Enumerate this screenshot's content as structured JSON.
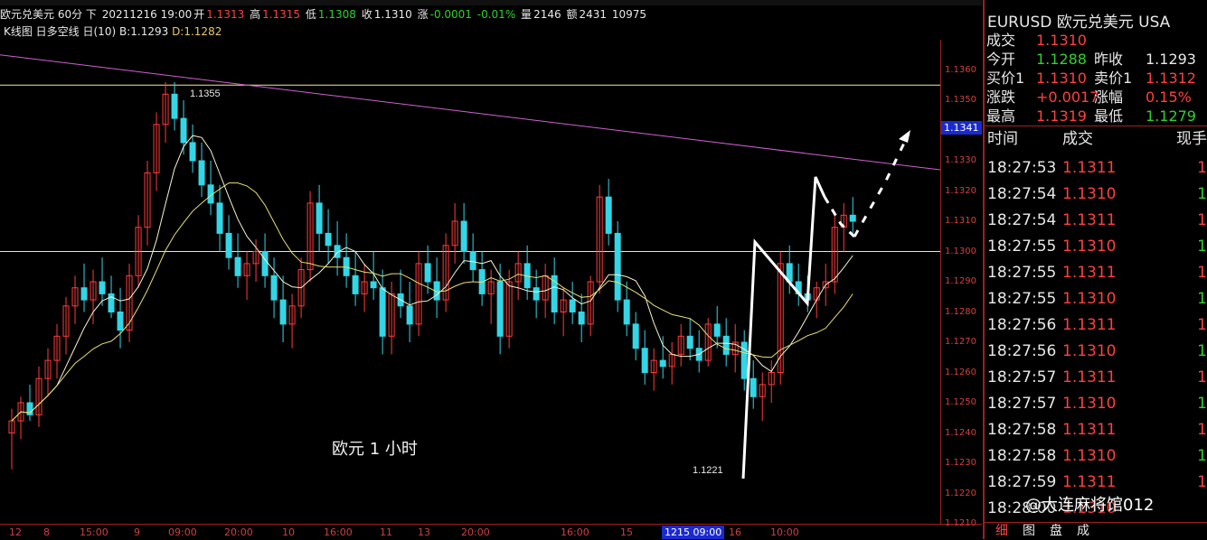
{
  "infobar": {
    "symbol_period": "欧元兑美元 60分 下",
    "datetime": "20211216 19:00",
    "open_label": "开",
    "open": "1.1313",
    "high_label": "高",
    "high": "1.1315",
    "low_label": "低",
    "low": "1.1308",
    "close_label": "收",
    "close": "1.1310",
    "change_label": "涨",
    "change": "-0.0001",
    "change_pct": "-0.01%",
    "volume_label": "量",
    "volume": "2146",
    "amount_label": "额",
    "amount": "2431",
    "extra": "10975"
  },
  "indicator_bar": {
    "name": "K线图 日多空线 日(10)",
    "b": "B:1.1293",
    "d": "D:1.1282"
  },
  "price_axis": {
    "ticks": [
      "1.1360",
      "1.1350",
      "1.1340",
      "1.1330",
      "1.1320",
      "1.1310",
      "1.1300",
      "1.1290",
      "1.1280",
      "1.1270",
      "1.1260",
      "1.1250",
      "1.1240",
      "1.1230",
      "1.1220",
      "1.1210"
    ],
    "current_price": "1.1341"
  },
  "time_axis": {
    "labels": [
      "12",
      "8",
      "15:00",
      "9",
      "09:00",
      "20:00",
      "10",
      "16:00",
      "11",
      "13",
      "20:00",
      "16:00",
      "15",
      "1215 09:00",
      "16",
      "10:00"
    ],
    "highlight": "1215 09:00"
  },
  "annotations": {
    "high_label": "1.1355",
    "low_label": "1.1221",
    "chart_text": "欧元  1 小时"
  },
  "quote": {
    "title": "EURUSD  欧元兑美元    USA",
    "rows": [
      {
        "label": "成交",
        "value": "1.1310",
        "color": "#ff4040"
      },
      {
        "label": "今开",
        "value": "1.1288",
        "color": "#2fd12f",
        "label2": "昨收",
        "value2": "1.1293",
        "color2": "#e8e8e8"
      },
      {
        "label": "买价1",
        "value": "1.1310",
        "color": "#ff4040",
        "label2": "卖价1",
        "value2": "1.1312",
        "color2": "#ff4040"
      },
      {
        "label": "涨跌",
        "value": "+0.0017",
        "color": "#ff4040",
        "label2": "涨幅",
        "value2": "0.15%",
        "color2": "#ff4040"
      },
      {
        "label": "最高",
        "value": "1.1319",
        "color": "#ff4040",
        "label2": "最低",
        "value2": "1.1279",
        "color2": "#2fd12f"
      }
    ],
    "head_time": "时间",
    "head_price": "成交",
    "head_hand": "现手",
    "ticks": [
      {
        "time": "18:27:53",
        "price": "1.1311",
        "hand": "1",
        "pc": "#ff4040",
        "hc": "#ff4040"
      },
      {
        "time": "18:27:54",
        "price": "1.1310",
        "hand": "1",
        "pc": "#ff4040",
        "hc": "#2fd12f"
      },
      {
        "time": "18:27:54",
        "price": "1.1311",
        "hand": "1",
        "pc": "#ff4040",
        "hc": "#ff4040"
      },
      {
        "time": "18:27:55",
        "price": "1.1310",
        "hand": "1",
        "pc": "#ff4040",
        "hc": "#2fd12f"
      },
      {
        "time": "18:27:55",
        "price": "1.1311",
        "hand": "1",
        "pc": "#ff4040",
        "hc": "#ff4040"
      },
      {
        "time": "18:27:55",
        "price": "1.1310",
        "hand": "1",
        "pc": "#ff4040",
        "hc": "#2fd12f"
      },
      {
        "time": "18:27:56",
        "price": "1.1311",
        "hand": "1",
        "pc": "#ff4040",
        "hc": "#ff4040"
      },
      {
        "time": "18:27:56",
        "price": "1.1310",
        "hand": "1",
        "pc": "#ff4040",
        "hc": "#2fd12f"
      },
      {
        "time": "18:27:57",
        "price": "1.1311",
        "hand": "1",
        "pc": "#ff4040",
        "hc": "#ff4040"
      },
      {
        "time": "18:27:57",
        "price": "1.1310",
        "hand": "1",
        "pc": "#ff4040",
        "hc": "#2fd12f"
      },
      {
        "time": "18:27:58",
        "price": "1.1311",
        "hand": "1",
        "pc": "#ff4040",
        "hc": "#ff4040"
      },
      {
        "time": "18:27:58",
        "price": "1.1310",
        "hand": "1",
        "pc": "#ff4040",
        "hc": "#2fd12f"
      },
      {
        "time": "18:27:59",
        "price": "1.1311",
        "hand": "1",
        "pc": "#ff4040",
        "hc": "#ff4040"
      },
      {
        "time": "18:28:00",
        "price": "1.1310",
        "hand": "",
        "pc": "#ff4040",
        "hc": "#2fd12f"
      }
    ],
    "tabs": [
      "细",
      "图",
      "盘",
      "成"
    ]
  },
  "watermark": "@大连麻将馆012",
  "colors": {
    "up": "#ff3b3b",
    "down": "#33d6e6",
    "ma1": "#f5f5d0",
    "ma2": "#e8e070",
    "trend": "#d060d0",
    "hline": "#f0e8a0",
    "axis": "#a02020"
  },
  "chart_data": {
    "type": "candlestick",
    "ylim": [
      1.121,
      1.137
    ],
    "overlays": {
      "resistance_line_from": 1.1365,
      "resistance_line_to": 1.1327,
      "hline_high": 1.1355,
      "hline_mid": 1.13
    },
    "candles": [
      [
        1.124,
        1.1248,
        1.1228,
        1.1244
      ],
      [
        1.1244,
        1.1252,
        1.1238,
        1.125
      ],
      [
        1.125,
        1.1256,
        1.1244,
        1.1246
      ],
      [
        1.1246,
        1.1262,
        1.1242,
        1.1258
      ],
      [
        1.1258,
        1.1268,
        1.1252,
        1.1264
      ],
      [
        1.1264,
        1.1276,
        1.1258,
        1.1272
      ],
      [
        1.1272,
        1.1285,
        1.1266,
        1.1282
      ],
      [
        1.1282,
        1.1292,
        1.1276,
        1.1288
      ],
      [
        1.1288,
        1.1296,
        1.128,
        1.1284
      ],
      [
        1.1284,
        1.1294,
        1.1276,
        1.129
      ],
      [
        1.129,
        1.1298,
        1.1282,
        1.1286
      ],
      [
        1.1286,
        1.1292,
        1.1278,
        1.128
      ],
      [
        1.128,
        1.1288,
        1.1268,
        1.1274
      ],
      [
        1.1274,
        1.1296,
        1.127,
        1.1292
      ],
      [
        1.1292,
        1.1312,
        1.1288,
        1.1308
      ],
      [
        1.1308,
        1.133,
        1.1302,
        1.1326
      ],
      [
        1.1326,
        1.1346,
        1.132,
        1.1342
      ],
      [
        1.1342,
        1.1356,
        1.1336,
        1.1352
      ],
      [
        1.1352,
        1.1356,
        1.134,
        1.1344
      ],
      [
        1.1344,
        1.135,
        1.1332,
        1.1336
      ],
      [
        1.1336,
        1.1342,
        1.1326,
        1.133
      ],
      [
        1.133,
        1.1336,
        1.1318,
        1.1322
      ],
      [
        1.1322,
        1.133,
        1.1312,
        1.1316
      ],
      [
        1.1316,
        1.1322,
        1.13,
        1.1306
      ],
      [
        1.1306,
        1.1312,
        1.1294,
        1.1298
      ],
      [
        1.1298,
        1.1306,
        1.1288,
        1.1292
      ],
      [
        1.1292,
        1.13,
        1.1284,
        1.1296
      ],
      [
        1.1296,
        1.1304,
        1.129,
        1.13
      ],
      [
        1.13,
        1.1306,
        1.1288,
        1.1292
      ],
      [
        1.1292,
        1.1298,
        1.1278,
        1.1284
      ],
      [
        1.1284,
        1.1292,
        1.127,
        1.1276
      ],
      [
        1.1276,
        1.1286,
        1.1268,
        1.1282
      ],
      [
        1.1282,
        1.1298,
        1.1278,
        1.1294
      ],
      [
        1.1294,
        1.132,
        1.129,
        1.1316
      ],
      [
        1.1316,
        1.1322,
        1.13,
        1.1306
      ],
      [
        1.1306,
        1.1314,
        1.1296,
        1.1302
      ],
      [
        1.1302,
        1.131,
        1.1292,
        1.1298
      ],
      [
        1.1298,
        1.1306,
        1.1288,
        1.1292
      ],
      [
        1.1292,
        1.13,
        1.1282,
        1.1286
      ],
      [
        1.1286,
        1.1296,
        1.128,
        1.129
      ],
      [
        1.129,
        1.13,
        1.1284,
        1.1288
      ],
      [
        1.1288,
        1.1294,
        1.1266,
        1.1272
      ],
      [
        1.1272,
        1.129,
        1.1266,
        1.1286
      ],
      [
        1.1286,
        1.1294,
        1.1278,
        1.1282
      ],
      [
        1.1282,
        1.129,
        1.127,
        1.1276
      ],
      [
        1.1276,
        1.13,
        1.1272,
        1.1296
      ],
      [
        1.1296,
        1.1302,
        1.1286,
        1.129
      ],
      [
        1.129,
        1.1298,
        1.1278,
        1.1284
      ],
      [
        1.1284,
        1.1306,
        1.128,
        1.1302
      ],
      [
        1.1302,
        1.1316,
        1.1296,
        1.131
      ],
      [
        1.131,
        1.1316,
        1.1296,
        1.13
      ],
      [
        1.13,
        1.1306,
        1.129,
        1.1294
      ],
      [
        1.1294,
        1.13,
        1.1282,
        1.1286
      ],
      [
        1.1286,
        1.1294,
        1.1276,
        1.129
      ],
      [
        1.129,
        1.1296,
        1.1266,
        1.1272
      ],
      [
        1.1272,
        1.1294,
        1.1268,
        1.129
      ],
      [
        1.129,
        1.13,
        1.1284,
        1.1296
      ],
      [
        1.1296,
        1.1302,
        1.1284,
        1.1288
      ],
      [
        1.1288,
        1.1294,
        1.1278,
        1.1284
      ],
      [
        1.1284,
        1.1296,
        1.1278,
        1.1292
      ],
      [
        1.1292,
        1.1298,
        1.1276,
        1.128
      ],
      [
        1.128,
        1.1288,
        1.1272,
        1.1284
      ],
      [
        1.1284,
        1.129,
        1.1276,
        1.128
      ],
      [
        1.128,
        1.1286,
        1.127,
        1.1276
      ],
      [
        1.1276,
        1.1292,
        1.1272,
        1.129
      ],
      [
        1.129,
        1.1322,
        1.1286,
        1.1318
      ],
      [
        1.1318,
        1.1324,
        1.1302,
        1.1306
      ],
      [
        1.1306,
        1.131,
        1.128,
        1.1284
      ],
      [
        1.1284,
        1.129,
        1.1272,
        1.1276
      ],
      [
        1.1276,
        1.128,
        1.1264,
        1.1268
      ],
      [
        1.1268,
        1.1274,
        1.1256,
        1.126
      ],
      [
        1.126,
        1.1268,
        1.1254,
        1.1264
      ],
      [
        1.1264,
        1.1272,
        1.1258,
        1.1262
      ],
      [
        1.1262,
        1.127,
        1.1256,
        1.1266
      ],
      [
        1.1266,
        1.1276,
        1.1262,
        1.1272
      ],
      [
        1.1272,
        1.1278,
        1.1264,
        1.1268
      ],
      [
        1.1268,
        1.1274,
        1.126,
        1.1264
      ],
      [
        1.1264,
        1.1278,
        1.1262,
        1.1276
      ],
      [
        1.1276,
        1.1282,
        1.1268,
        1.1272
      ],
      [
        1.1272,
        1.1278,
        1.1262,
        1.1266
      ],
      [
        1.1266,
        1.1276,
        1.126,
        1.127
      ],
      [
        1.127,
        1.1274,
        1.1254,
        1.1258
      ],
      [
        1.1258,
        1.1264,
        1.1248,
        1.1252
      ],
      [
        1.1252,
        1.126,
        1.1244,
        1.1256
      ],
      [
        1.1256,
        1.1264,
        1.125,
        1.126
      ],
      [
        1.126,
        1.13,
        1.1256,
        1.1296
      ],
      [
        1.1296,
        1.1302,
        1.1286,
        1.129
      ],
      [
        1.129,
        1.1296,
        1.1282,
        1.1286
      ],
      [
        1.1286,
        1.1292,
        1.128,
        1.1284
      ],
      [
        1.1284,
        1.129,
        1.1278,
        1.1288
      ],
      [
        1.1288,
        1.1296,
        1.1282,
        1.129
      ],
      [
        1.129,
        1.1312,
        1.1286,
        1.1308
      ],
      [
        1.1308,
        1.1316,
        1.13,
        1.1312
      ],
      [
        1.1312,
        1.1318,
        1.1306,
        1.131
      ]
    ]
  }
}
